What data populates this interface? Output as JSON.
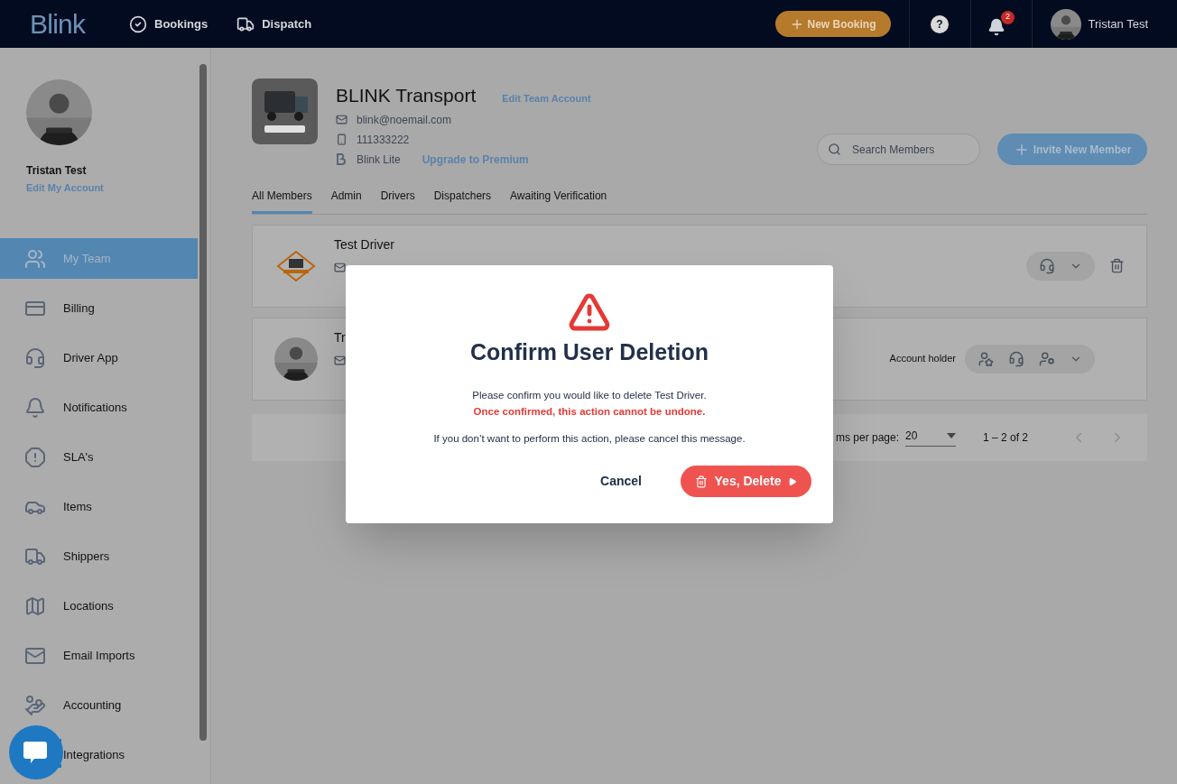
{
  "header": {
    "logo": "Blink",
    "nav": [
      "Bookings",
      "Dispatch"
    ],
    "new_booking": "New Booking",
    "help": "?",
    "notification_count": "2",
    "user_name": "Tristan Test"
  },
  "sidebar": {
    "user_name": "Tristan Test",
    "edit_link": "Edit My Account",
    "items": [
      {
        "label": "My Team",
        "selected": true
      },
      {
        "label": "Billing",
        "selected": false
      },
      {
        "label": "Driver App",
        "selected": false
      },
      {
        "label": "Notifications",
        "selected": false
      },
      {
        "label": "SLA's",
        "selected": false
      },
      {
        "label": "Items",
        "selected": false
      },
      {
        "label": "Shippers",
        "selected": false
      },
      {
        "label": "Locations",
        "selected": false
      },
      {
        "label": "Email Imports",
        "selected": false
      },
      {
        "label": "Accounting",
        "selected": false
      },
      {
        "label": "Integrations",
        "selected": false
      }
    ]
  },
  "team": {
    "name": "BLINK Transport",
    "edit_link": "Edit Team Account",
    "email": "blink@noemail.com",
    "phone": "111333222",
    "plan": "Blink Lite",
    "upgrade_link": "Upgrade to Premium"
  },
  "search": {
    "placeholder": "Search Members"
  },
  "invite_button": "Invite New Member",
  "tabs": [
    {
      "label": "All Members",
      "selected": true
    },
    {
      "label": "Admin",
      "selected": false
    },
    {
      "label": "Drivers",
      "selected": false
    },
    {
      "label": "Dispatchers",
      "selected": false
    },
    {
      "label": "Awaiting Verification",
      "selected": false
    }
  ],
  "members": [
    {
      "name": "Test Driver",
      "kind": "logo"
    },
    {
      "name": "Tr",
      "role": "Account holder"
    }
  ],
  "pagination": {
    "per_page_label": "ms per page:",
    "per_page": "20",
    "range": "1 – 2 of 2"
  },
  "dialog": {
    "title": "Confirm User Deletion",
    "message": "Please confirm you would like to delete Test Driver.",
    "warning": "Once confirmed, this action cannot be undone.",
    "note": "If you don’t want to perform this action, please cancel this message.",
    "cancel": "Cancel",
    "confirm": "Yes, Delete"
  }
}
